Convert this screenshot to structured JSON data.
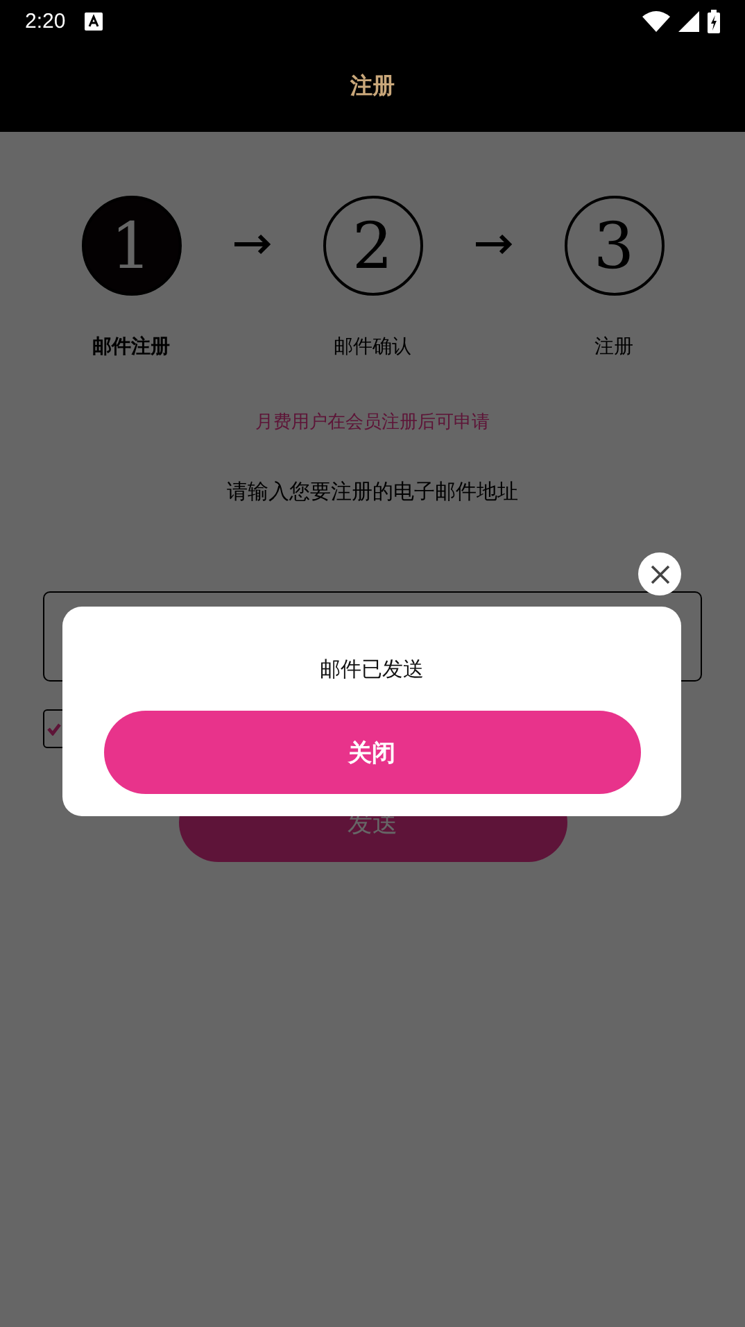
{
  "status_bar": {
    "time": "2:20"
  },
  "app_bar": {
    "title": "注册"
  },
  "steps": [
    {
      "number": "1",
      "label": "邮件注册",
      "selected": true
    },
    {
      "number": "2",
      "label": "邮件确认",
      "selected": false
    },
    {
      "number": "3",
      "label": "注册",
      "selected": false
    }
  ],
  "notice": "月费用户在会员注册后可申请",
  "instruction": "请输入您要注册的电子邮件地址",
  "agree_checkbox": {
    "checked": true
  },
  "send_button": "发送",
  "dialog": {
    "message": "邮件已发送",
    "button": "关闭"
  }
}
